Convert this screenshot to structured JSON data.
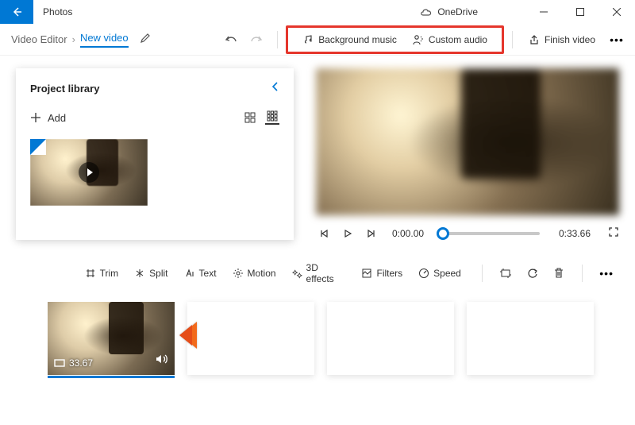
{
  "app": {
    "title": "Photos",
    "onedrive": "OneDrive"
  },
  "breadcrumb": {
    "root": "Video Editor",
    "current": "New video"
  },
  "commands": {
    "bg_music": "Background music",
    "custom_audio": "Custom audio",
    "finish": "Finish video"
  },
  "library": {
    "title": "Project library",
    "add_label": "Add"
  },
  "preview": {
    "t_current": "0:00.00",
    "t_total": "0:33.66"
  },
  "story_tools": {
    "trim": "Trim",
    "split": "Split",
    "text": "Text",
    "motion": "Motion",
    "effects": "3D effects",
    "filters": "Filters",
    "speed": "Speed"
  },
  "storyboard": {
    "clip_duration": "33.67"
  }
}
